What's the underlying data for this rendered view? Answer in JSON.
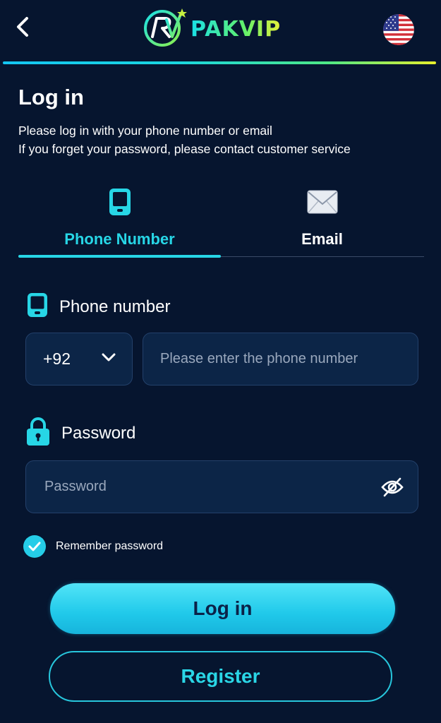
{
  "header": {
    "brand": "PAKVIP",
    "back_icon": "chevron-left-icon",
    "language_icon": "us-flag-icon"
  },
  "page": {
    "title": "Log in",
    "subtitle_line1": "Please log in with your phone number or email",
    "subtitle_line2": "If you forget your password, please contact customer service"
  },
  "tabs": [
    {
      "label": "Phone Number",
      "icon": "phone-icon",
      "active": true
    },
    {
      "label": "Email",
      "icon": "envelope-icon",
      "active": false
    }
  ],
  "phone": {
    "label": "Phone number",
    "country_code": "+92",
    "placeholder": "Please enter the phone number"
  },
  "password": {
    "label": "Password",
    "placeholder": "Password"
  },
  "remember": {
    "label": "Remember password",
    "checked": true
  },
  "buttons": {
    "login": "Log in",
    "register": "Register"
  },
  "colors": {
    "background": "#06152f",
    "accent": "#27d6e6",
    "input_bg": "#0c2547"
  }
}
